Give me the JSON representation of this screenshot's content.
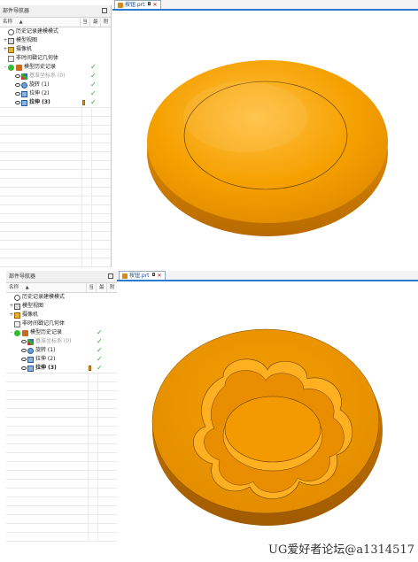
{
  "panels": [
    {
      "navigator_title": "部件导航器",
      "columns": {
        "name": "名称",
        "sort": "▲",
        "c2": "当",
        "c3": "最",
        "c4": "附"
      },
      "tree": [
        {
          "expand": "",
          "icon": "history-mode-icon",
          "label": "历史记录建模模式",
          "dim": false,
          "check": "",
          "tool": false,
          "indent": 0
        },
        {
          "expand": "+",
          "icon": "model-views-icon",
          "label": "模型视图",
          "dim": false,
          "check": "",
          "tool": false,
          "indent": 0
        },
        {
          "expand": "+",
          "icon": "camera-icon",
          "label": "摄像机",
          "dim": false,
          "check": "",
          "tool": false,
          "indent": 0
        },
        {
          "expand": "",
          "icon": "folder-icon",
          "label": "非时间戳记几何体",
          "dim": false,
          "check": "",
          "tool": false,
          "indent": 0
        },
        {
          "expand": "-",
          "icon": "model-history-icon",
          "label": "模型历史记录",
          "dim": false,
          "check": "✓",
          "tool": false,
          "indent": 0
        },
        {
          "expand": "",
          "icon": "datum-csys-icon",
          "label": "基准坐标系 (0)",
          "dim": true,
          "check": "✓",
          "tool": false,
          "indent": 1
        },
        {
          "expand": "",
          "icon": "revolve-icon",
          "label": "旋转 (1)",
          "dim": false,
          "check": "✓",
          "tool": false,
          "indent": 1
        },
        {
          "expand": "",
          "icon": "extrude-icon",
          "label": "拉伸 (2)",
          "dim": false,
          "check": "✓",
          "tool": false,
          "indent": 1
        },
        {
          "expand": "",
          "icon": "extrude-icon",
          "label": "拉伸 (3)",
          "dim": false,
          "check": "✓",
          "tool": true,
          "indent": 1
        }
      ],
      "tab": {
        "label": "按钮.prt",
        "pin": "◘",
        "close": "✕"
      }
    },
    {
      "navigator_title": "部件导航器",
      "columns": {
        "name": "名称",
        "sort": "▲",
        "c2": "当",
        "c3": "最",
        "c4": "附"
      },
      "tree": [
        {
          "expand": "",
          "icon": "history-mode-icon",
          "label": "历史记录建模模式",
          "dim": false,
          "check": "",
          "tool": false,
          "indent": 0
        },
        {
          "expand": "+",
          "icon": "model-views-icon",
          "label": "模型视图",
          "dim": false,
          "check": "",
          "tool": false,
          "indent": 0
        },
        {
          "expand": "+",
          "icon": "camera-icon",
          "label": "摄像机",
          "dim": false,
          "check": "",
          "tool": false,
          "indent": 0
        },
        {
          "expand": "",
          "icon": "folder-icon",
          "label": "非时间戳记几何体",
          "dim": false,
          "check": "",
          "tool": false,
          "indent": 0
        },
        {
          "expand": "-",
          "icon": "model-history-icon",
          "label": "模型历史记录",
          "dim": false,
          "check": "✓",
          "tool": false,
          "indent": 0
        },
        {
          "expand": "",
          "icon": "datum-csys-icon",
          "label": "基准坐标系 (0)",
          "dim": true,
          "check": "✓",
          "tool": false,
          "indent": 1
        },
        {
          "expand": "",
          "icon": "revolve-icon",
          "label": "旋转 (1)",
          "dim": false,
          "check": "✓",
          "tool": false,
          "indent": 1
        },
        {
          "expand": "",
          "icon": "extrude-icon",
          "label": "拉伸 (2)",
          "dim": false,
          "check": "✓",
          "tool": false,
          "indent": 1
        },
        {
          "expand": "",
          "icon": "extrude-icon",
          "label": "拉伸 (3)",
          "dim": false,
          "check": "✓",
          "tool": true,
          "indent": 1
        }
      ],
      "tab": {
        "label": "按钮.prt",
        "pin": "◘",
        "close": "✕"
      }
    }
  ],
  "colors": {
    "model_orange": "#f5a000",
    "model_dark": "#c47200",
    "check_green": "#22aa22",
    "tab_accent": "#2b7bd0"
  },
  "watermark": "UG爱好者论坛@a1314517"
}
